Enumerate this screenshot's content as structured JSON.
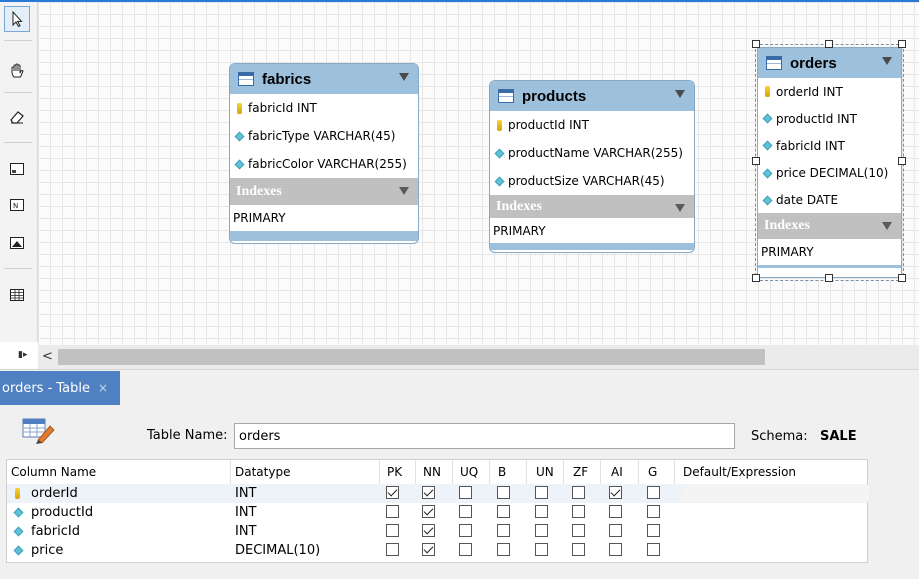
{
  "colors": {
    "accent": "#2b79d6",
    "entity_header": "#9dc0dc",
    "index_header": "#c0c0c0",
    "tab_active": "#4f81c2"
  },
  "toolbar": {
    "tools": [
      "pointer-icon",
      "hand-icon",
      "eraser-icon",
      "layer-icon",
      "note-icon",
      "image-icon",
      "table-icon"
    ]
  },
  "entities": [
    {
      "name": "fabrics",
      "columns": [
        {
          "type": "pk",
          "label": "fabricId INT"
        },
        {
          "type": "col",
          "label": "fabricType VARCHAR(45)"
        },
        {
          "type": "col",
          "label": "fabricColor VARCHAR(255)"
        }
      ],
      "indexes_label": "Indexes",
      "indexes": [
        "PRIMARY"
      ]
    },
    {
      "name": "products",
      "columns": [
        {
          "type": "pk",
          "label": "productId INT"
        },
        {
          "type": "col",
          "label": "productName VARCHAR(255)"
        },
        {
          "type": "col",
          "label": "productSize VARCHAR(45)"
        }
      ],
      "indexes_label": "Indexes",
      "indexes": [
        "PRIMARY"
      ]
    },
    {
      "name": "orders",
      "columns": [
        {
          "type": "pk",
          "label": "orderId INT"
        },
        {
          "type": "col",
          "label": "productId INT"
        },
        {
          "type": "col",
          "label": "fabricId INT"
        },
        {
          "type": "col",
          "label": "price DECIMAL(10)"
        },
        {
          "type": "col",
          "label": "date DATE"
        }
      ],
      "indexes_label": "Indexes",
      "indexes": [
        "PRIMARY"
      ]
    }
  ],
  "tab": {
    "label": "orders - Table",
    "close": "×"
  },
  "editor": {
    "table_name_label": "Table Name:",
    "table_name_value": "orders",
    "schema_label": "Schema:",
    "schema_value": "SALE",
    "columns_header": [
      "Column Name",
      "Datatype",
      "PK",
      "NN",
      "UQ",
      "B",
      "UN",
      "ZF",
      "AI",
      "G",
      "Default/Expression"
    ],
    "rows": [
      {
        "name": "orderId",
        "key": "pk",
        "datatype": "INT",
        "flags": {
          "PK": true,
          "NN": true,
          "UQ": false,
          "B": false,
          "UN": false,
          "ZF": false,
          "AI": true,
          "G": false
        }
      },
      {
        "name": "productId",
        "key": "col",
        "datatype": "INT",
        "flags": {
          "PK": false,
          "NN": true,
          "UQ": false,
          "B": false,
          "UN": false,
          "ZF": false,
          "AI": false,
          "G": false
        }
      },
      {
        "name": "fabricId",
        "key": "col",
        "datatype": "INT",
        "flags": {
          "PK": false,
          "NN": true,
          "UQ": false,
          "B": false,
          "UN": false,
          "ZF": false,
          "AI": false,
          "G": false
        }
      },
      {
        "name": "price",
        "key": "col",
        "datatype": "DECIMAL(10)",
        "flags": {
          "PK": false,
          "NN": true,
          "UQ": false,
          "B": false,
          "UN": false,
          "ZF": false,
          "AI": false,
          "G": false
        }
      }
    ]
  }
}
